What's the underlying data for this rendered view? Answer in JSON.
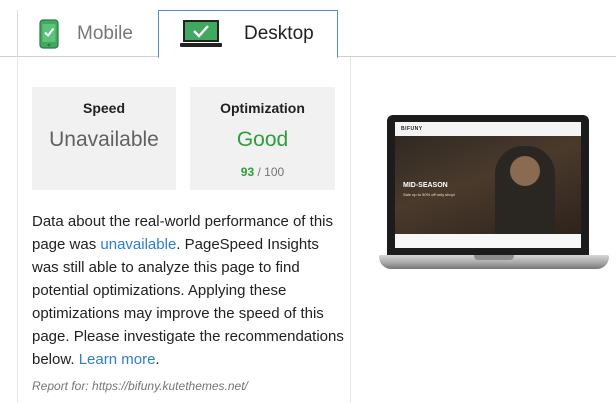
{
  "tabs": [
    {
      "label": "Mobile",
      "icon": "mobile-phone-icon",
      "active": false
    },
    {
      "label": "Desktop",
      "icon": "desktop-monitor-icon",
      "active": true
    }
  ],
  "speed": {
    "title": "Speed",
    "value": "Unavailable"
  },
  "optimization": {
    "title": "Optimization",
    "value": "Good",
    "score": "93",
    "score_suffix": " / 100"
  },
  "description": {
    "part1": "Data about the real-world performance of this page was ",
    "link1": "unavailable",
    "part2": ". PageSpeed Insights was still able to analyze this page to find potential optimizations. Applying these optimizations may improve the speed of this page. Please investigate the recommendations below. ",
    "link2": "Learn more",
    "part3": "."
  },
  "report": "Report for: https://bifuny.kutethemes.net/",
  "preview": {
    "brand": "BIFUNY",
    "hero_title": "MID-SEASON",
    "hero_sub": "Sale up to 50% off only shop!"
  },
  "colors": {
    "good": "#2e9e3c",
    "link": "#2d7dd2",
    "active_tab_border": "#4f8ac9"
  }
}
